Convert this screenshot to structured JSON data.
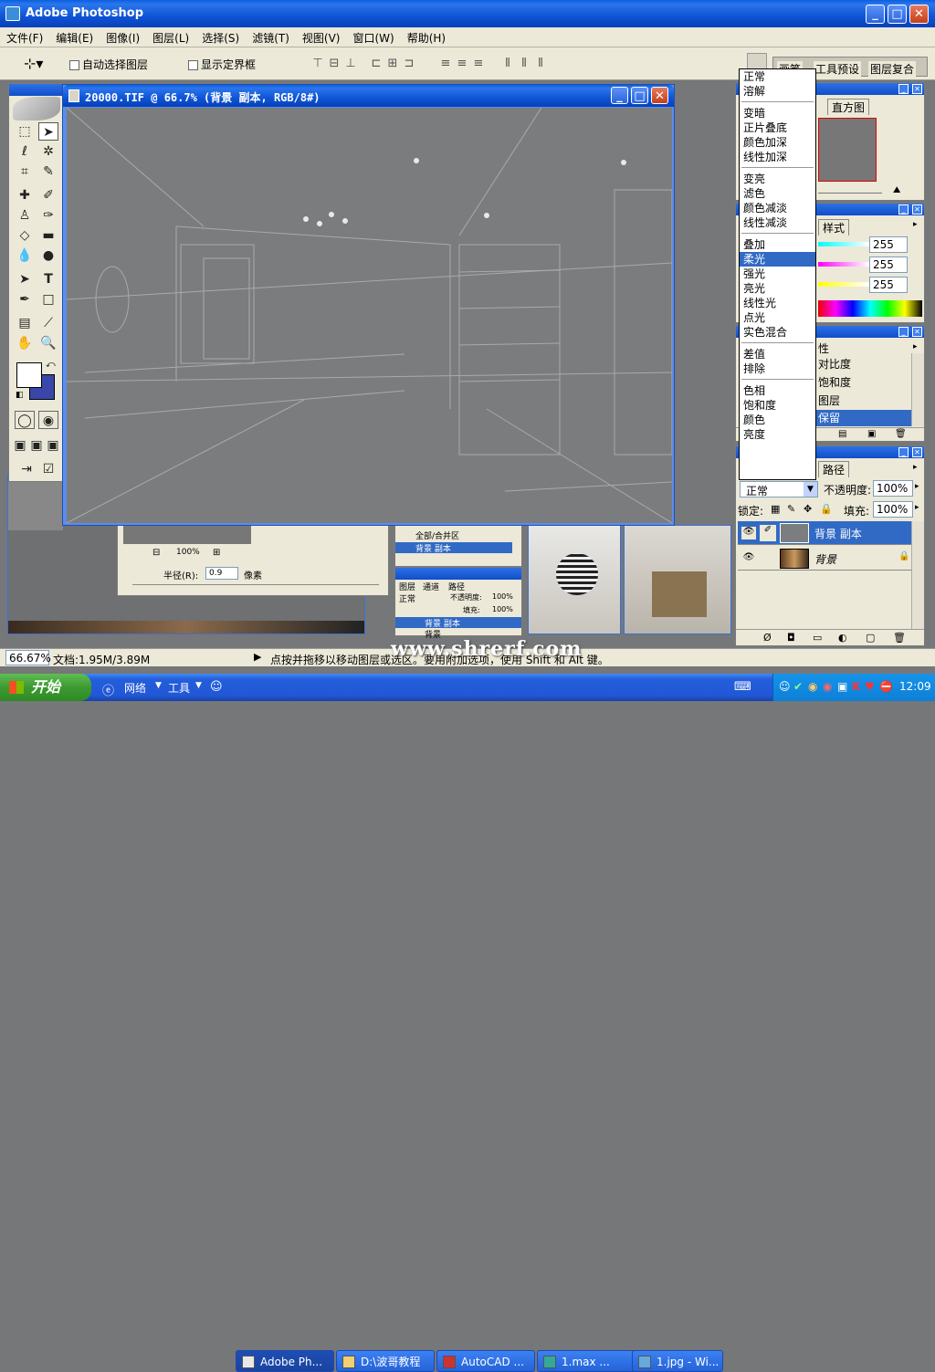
{
  "app": {
    "title": "Adobe Photoshop"
  },
  "menu": [
    "文件(F)",
    "编辑(E)",
    "图像(I)",
    "图层(L)",
    "选择(S)",
    "滤镜(T)",
    "视图(V)",
    "窗口(W)",
    "帮助(H)"
  ],
  "options": {
    "auto_select": "自动选择图层",
    "show_bounds": "显示定界框"
  },
  "document": {
    "title": "20000.TIF @ 66.7% (背景 副本, RGB/8#)"
  },
  "panel_tabs": {
    "brushes": "画笔",
    "tool_presets": "工具预设",
    "layer_comps": "图层复合"
  },
  "navigator": {
    "tab": "直方图"
  },
  "color_panel": {
    "tab": "样式",
    "r": "255",
    "g": "255",
    "b": "255"
  },
  "adjust_panel": {
    "tab_suffix": "性",
    "items": [
      "对比度",
      "饱和度",
      "图层",
      "保留"
    ]
  },
  "layers_panel": {
    "tab": "路径",
    "mode": "正常",
    "opacity_label": "不透明度:",
    "opacity": "100%",
    "lock_label": "锁定:",
    "fill_label": "填充:",
    "fill": "100%",
    "layers": [
      {
        "name": "背景 副本",
        "active": true
      },
      {
        "name": "背景",
        "active": false
      }
    ]
  },
  "blend_modes": [
    [
      "正常",
      "溶解"
    ],
    [
      "变暗",
      "正片叠底",
      "颜色加深",
      "线性加深"
    ],
    [
      "变亮",
      "滤色",
      "颜色减淡",
      "线性减淡"
    ],
    [
      "叠加",
      "柔光",
      "强光",
      "亮光",
      "线性光",
      "点光",
      "实色混合"
    ],
    [
      "差值",
      "排除"
    ],
    [
      "色相",
      "饱和度",
      "颜色",
      "亮度"
    ]
  ],
  "blend_selected": "柔光",
  "status": {
    "zoom": "66.67%",
    "doc": "文档:1.95M/3.89M",
    "hint": "点按并拖移以移动图层或选区。要用附加选项，使用 Shift 和 Alt 键。"
  },
  "watermark": "www.shrerf.com",
  "bg_windows": {
    "zoom": "100%",
    "radius_label": "半径(R):",
    "radius_value": "0.9",
    "radius_unit": "像素",
    "layer_a": "全部/合并区",
    "layer_b": "背景 副本",
    "mode": "正常",
    "opacity_label": "不透明度:",
    "opacity": "100%",
    "fill_label": "填充:",
    "fill": "100%",
    "layer_c": "背景 副本",
    "layer_d": "背景",
    "tab_a": "图层",
    "tab_b": "通道",
    "tab_c": "路径"
  },
  "taskbar": {
    "start": "开始",
    "net": "网络",
    "tools": "工具",
    "items": [
      "Adobe Ph...",
      "D:\\波哥教程",
      "AutoCAD ...",
      "1.max   ...",
      "1.jpg - Wi..."
    ],
    "clock": "12:09"
  }
}
